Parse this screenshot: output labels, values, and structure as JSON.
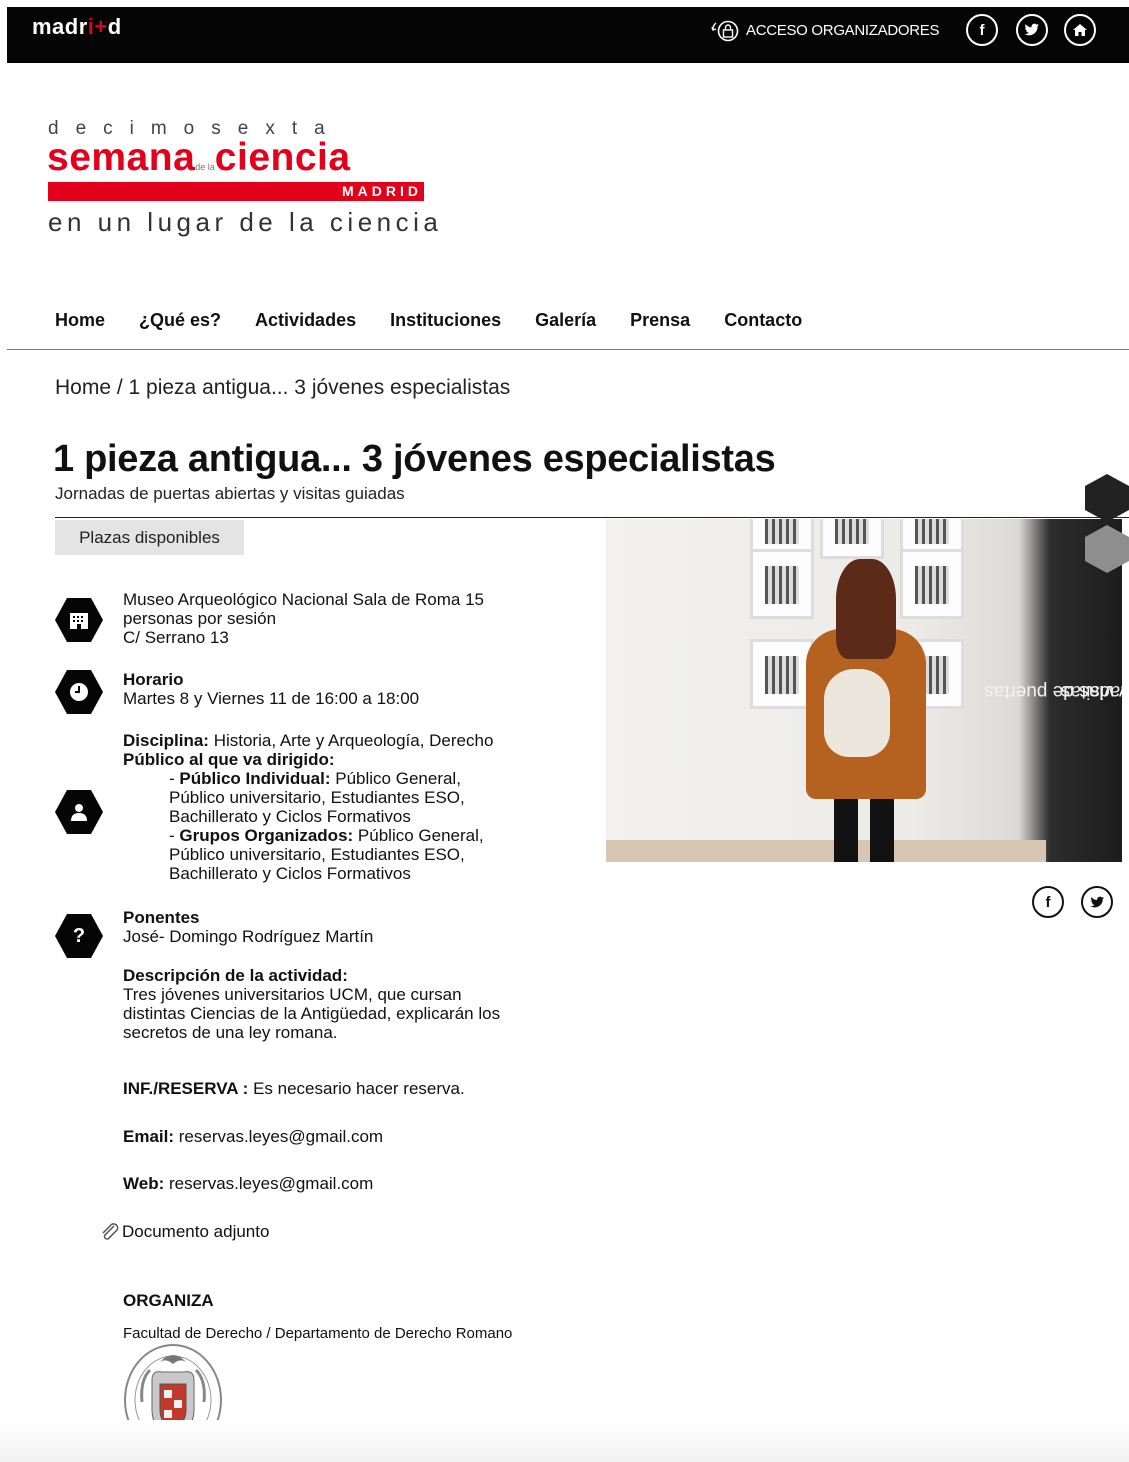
{
  "topbar": {
    "logo_part1": "madr",
    "logo_part2": "i",
    "logo_plus": "+",
    "logo_part3": "d",
    "access_label": "ACCESO ORGANIZADORES",
    "facebook": "f"
  },
  "brand": {
    "top": "decimosexta",
    "word1": "semana",
    "small": "de la",
    "word2": "ciencia",
    "city": "MADRID",
    "tagline": "en un lugar de la ciencia"
  },
  "nav": {
    "items": [
      "Home",
      "¿Qué es?",
      "Actividades",
      "Instituciones",
      "Galería",
      "Prensa",
      "Contacto"
    ]
  },
  "breadcrumb": "Home / 1 pieza antigua... 3 jóvenes especialistas",
  "title": "1 pieza antigua... 3 jóvenes especialistas",
  "subtitle": "Jornadas de puertas abiertas y visitas guiadas",
  "plazas": "Plazas disponibles",
  "location": {
    "line1": "Museo Arqueológico Nacional Sala de Roma 15",
    "line2": "personas por sesión",
    "line3": "C/ Serrano 13"
  },
  "horario": {
    "label": "Horario",
    "value": "Martes 8 y Viernes 11 de 16:00 a 18:00"
  },
  "disciplina": {
    "label": "Disciplina:",
    "value": "Historia, Arte y Arqueología, Derecho",
    "publico_label": "Público al que va dirigido:",
    "individual_prefix": "- ",
    "individual_label": "Público Individual:",
    "individual_value_1": "Público General,",
    "individual_value_2": "Público universitario, Estudiantes ESO,",
    "individual_value_3": "Bachillerato y Ciclos Formativos",
    "grupos_prefix": "- ",
    "grupos_label": "Grupos Organizados:",
    "grupos_value_1": "Público General,",
    "grupos_value_2": "Público universitario, Estudiantes ESO,",
    "grupos_value_3": "Bachillerato y Ciclos Formativos"
  },
  "ponentes": {
    "label": "Ponentes",
    "value": "José- Domingo Rodríguez Martín"
  },
  "descripcion": {
    "label": "Descripción de la actividad:",
    "line1": "Tres jóvenes universitarios UCM, que cursan",
    "line2": "distintas Ciencias de la Antigüedad, explicarán los",
    "line3": "secretos de una ley romana."
  },
  "reserva": {
    "label": "INF./RESERVA :",
    "value": "Es necesario hacer reserva."
  },
  "email": {
    "label": "Email:",
    "value": "reservas.leyes@gmail.com"
  },
  "web": {
    "label": "Web:",
    "value": "reservas.leyes@gmail.com"
  },
  "documento": "Documento adjunto",
  "organiza": {
    "label": "ORGANIZA",
    "value": "Facultad de Derecho / Departamento de Derecho Romano"
  },
  "photo_tag": {
    "line1": "Jornadas de puertas",
    "line2": "abiertas y visitas"
  },
  "share": {
    "facebook": "f"
  },
  "icons": {
    "building": "building-icon",
    "clock": "clock-icon",
    "person": "person-icon",
    "question": "question-icon",
    "question_glyph": "?",
    "paperclip": "paperclip-icon",
    "lock": "lock-icon",
    "twitter": "twitter-icon",
    "home": "home-icon"
  },
  "colors": {
    "brand_red": "#e3001b",
    "topbar": "#050505"
  }
}
